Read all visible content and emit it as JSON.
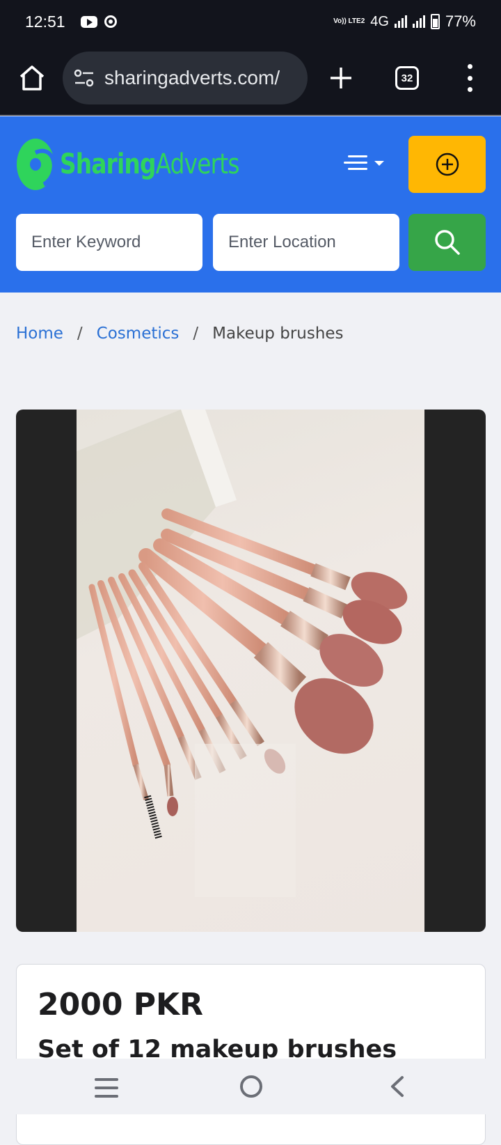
{
  "status_bar": {
    "time": "12:51",
    "volte": "Vo)) LTE2",
    "network": "4G",
    "battery": "77%"
  },
  "browser": {
    "url": "sharingadverts.com/",
    "tab_count": "32"
  },
  "header": {
    "logo_part1": "Sharing",
    "logo_part2": "Adverts",
    "keyword_placeholder": "Enter Keyword",
    "location_placeholder": "Enter Location"
  },
  "breadcrumb": {
    "home": "Home",
    "category": "Cosmetics",
    "current": "Makeup brushes",
    "separator": "/"
  },
  "listing": {
    "price": "2000 PKR",
    "title": "Set of 12 makeup brushes"
  },
  "colors": {
    "header_blue": "#2a70eb",
    "logo_green": "#2fd45b",
    "post_button_yellow": "#ffb703",
    "search_button_green": "#36a548"
  }
}
